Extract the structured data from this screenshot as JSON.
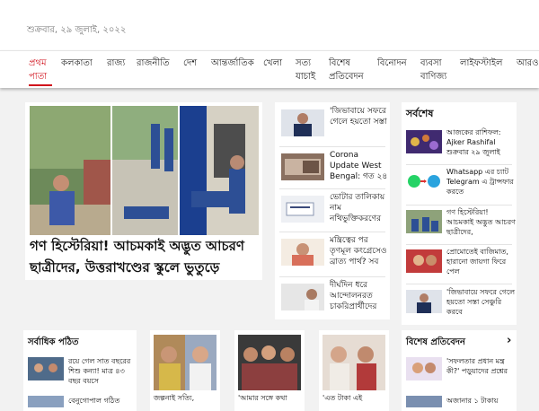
{
  "header": {
    "date": "শুক্রবার, ২৯ জুলাই, ২০২২"
  },
  "nav": {
    "items": [
      {
        "label": "প্রথম পাতা",
        "active": true
      },
      {
        "label": "কলকাতা"
      },
      {
        "label": "রাজ্য"
      },
      {
        "label": "রাজনীতি"
      },
      {
        "label": "দেশ"
      },
      {
        "label": "আন্তর্জাতিক"
      },
      {
        "label": "খেলা"
      },
      {
        "label": "সত্য যাচাই"
      },
      {
        "label": "বিশেষ প্রতিবেদন"
      },
      {
        "label": "বিনোদন"
      },
      {
        "label": "ব্যবসা বাণিজ্য"
      },
      {
        "label": "লাইফস্টাইল"
      },
      {
        "label": "আরও"
      }
    ]
  },
  "lead": {
    "headline": "গণ হিস্টেরিয়া! আচমকাই অদ্ভুত আচরণ ছাত্রীদের, উত্তরাখণ্ডের স্কুলে ভুতুড়ে"
  },
  "middle": {
    "items": [
      {
        "title": "'জিভাবায়ে সফরে গেলে হয়তো সস্তা"
      },
      {
        "title": "Corona Update West Bengal: গত ২৪"
      },
      {
        "title": "ভোটার তালিকায় নাম নথিভুক্তিকরণের"
      },
      {
        "title": "মন্ত্রিত্বের পর তৃণমূল কংগ্রেসেও ব্রাত্য পার্থ? সব"
      },
      {
        "title": "দীর্ঘদিন ধরে আন্দোলনরত চাকরিপ্রার্থীদের"
      }
    ]
  },
  "latest": {
    "heading": "সর্বশেষ",
    "items": [
      {
        "title": "আজকের রাশিফল: Ajker Rashifal শুক্রবার ২৯ জুলাই"
      },
      {
        "title": "Whatsapp এর চ্যাট Telegram এ ট্রান্সফার করতে"
      },
      {
        "title": "গণ হিস্টেরিয়া! আচমকাই অদ্ভুত আচরণ ছাত্রীদের,"
      },
      {
        "title": "প্রোমোতেই বাজিমাত, হারানো জায়গা ফিরে পেল"
      },
      {
        "title": "'জিভাবায়ে সফরে গেলে হয়তো সস্তা সেঞ্চুরি করবে"
      }
    ]
  },
  "most_read": {
    "heading": "সর্বাধিক পঠিত",
    "items": [
      {
        "title": "রয়ে গেল সাত বছরের শিশু কন্যা! মাত্র ৪৩ বছর বয়সে"
      },
      {
        "title": "বেনুগোপাল গঠিত"
      }
    ]
  },
  "bottom_cards": [
    {
      "title": "জল্পনাই সত্যি,"
    },
    {
      "title": "'আমার সঙ্গে কথা"
    },
    {
      "title": "'এত টাকা এই"
    }
  ],
  "special": {
    "heading": "বিশেষ প্রতিবেদন",
    "chevron": "›",
    "items": [
      {
        "title": "'সফলতার প্রধান মন্ত্র কী?' পড়ুয়াদের প্রশ্নের"
      },
      {
        "title": "অজানার ১ টাকায়"
      }
    ]
  }
}
